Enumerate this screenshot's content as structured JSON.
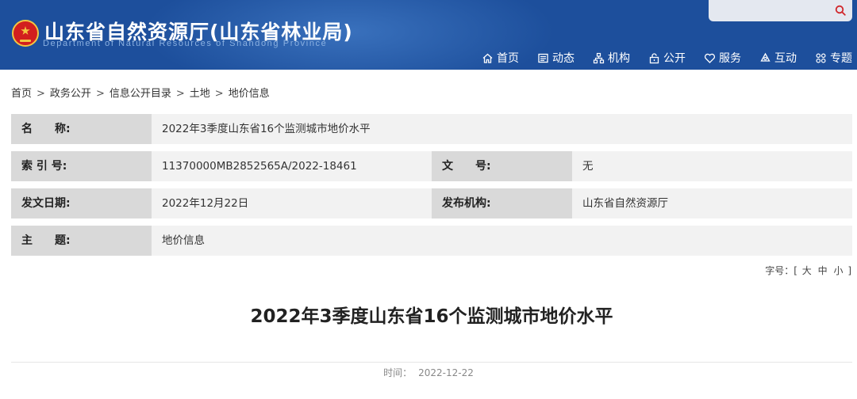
{
  "header": {
    "title": "山东省自然资源厅(山东省林业局)",
    "subtitle": "Department of Natural Resources of Shandong Province",
    "search_placeholder": "",
    "colors": {
      "background": "#1d4f9c",
      "emblem_red": "#d21e1e",
      "emblem_gold": "#f2c641"
    }
  },
  "nav": [
    {
      "icon": "home-icon",
      "label": "首页"
    },
    {
      "icon": "news-icon",
      "label": "动态"
    },
    {
      "icon": "org-chart-icon",
      "label": "机构"
    },
    {
      "icon": "lock-icon",
      "label": "公开"
    },
    {
      "icon": "heart-icon",
      "label": "服务"
    },
    {
      "icon": "interaction-icon",
      "label": "互动"
    },
    {
      "icon": "grid-icon",
      "label": "专题"
    }
  ],
  "breadcrumb": {
    "items": [
      "首页",
      "政务公开",
      "信息公开目录",
      "土地",
      "地价信息"
    ],
    "separator": ">"
  },
  "meta": {
    "name_label": "名　　称:",
    "name_value": "2022年3季度山东省16个监测城市地价水平",
    "index_label": "索 引 号:",
    "index_value": "11370000MB2852565A/2022-18461",
    "doc_no_label": "文　　号:",
    "doc_no_value": "无",
    "date_label": "发文日期:",
    "date_value": "2022年12月22日",
    "org_label": "发布机构:",
    "org_value": "山东省自然资源厅",
    "subject_label": "主　　题:",
    "subject_value": "地价信息"
  },
  "font_size": {
    "label": "字号：[",
    "large": "大",
    "medium": "中",
    "small": "小",
    "close": "]"
  },
  "article": {
    "title": "2022年3季度山东省16个监测城市地价水平",
    "time_label": "时间：",
    "time_value": "2022-12-22"
  }
}
